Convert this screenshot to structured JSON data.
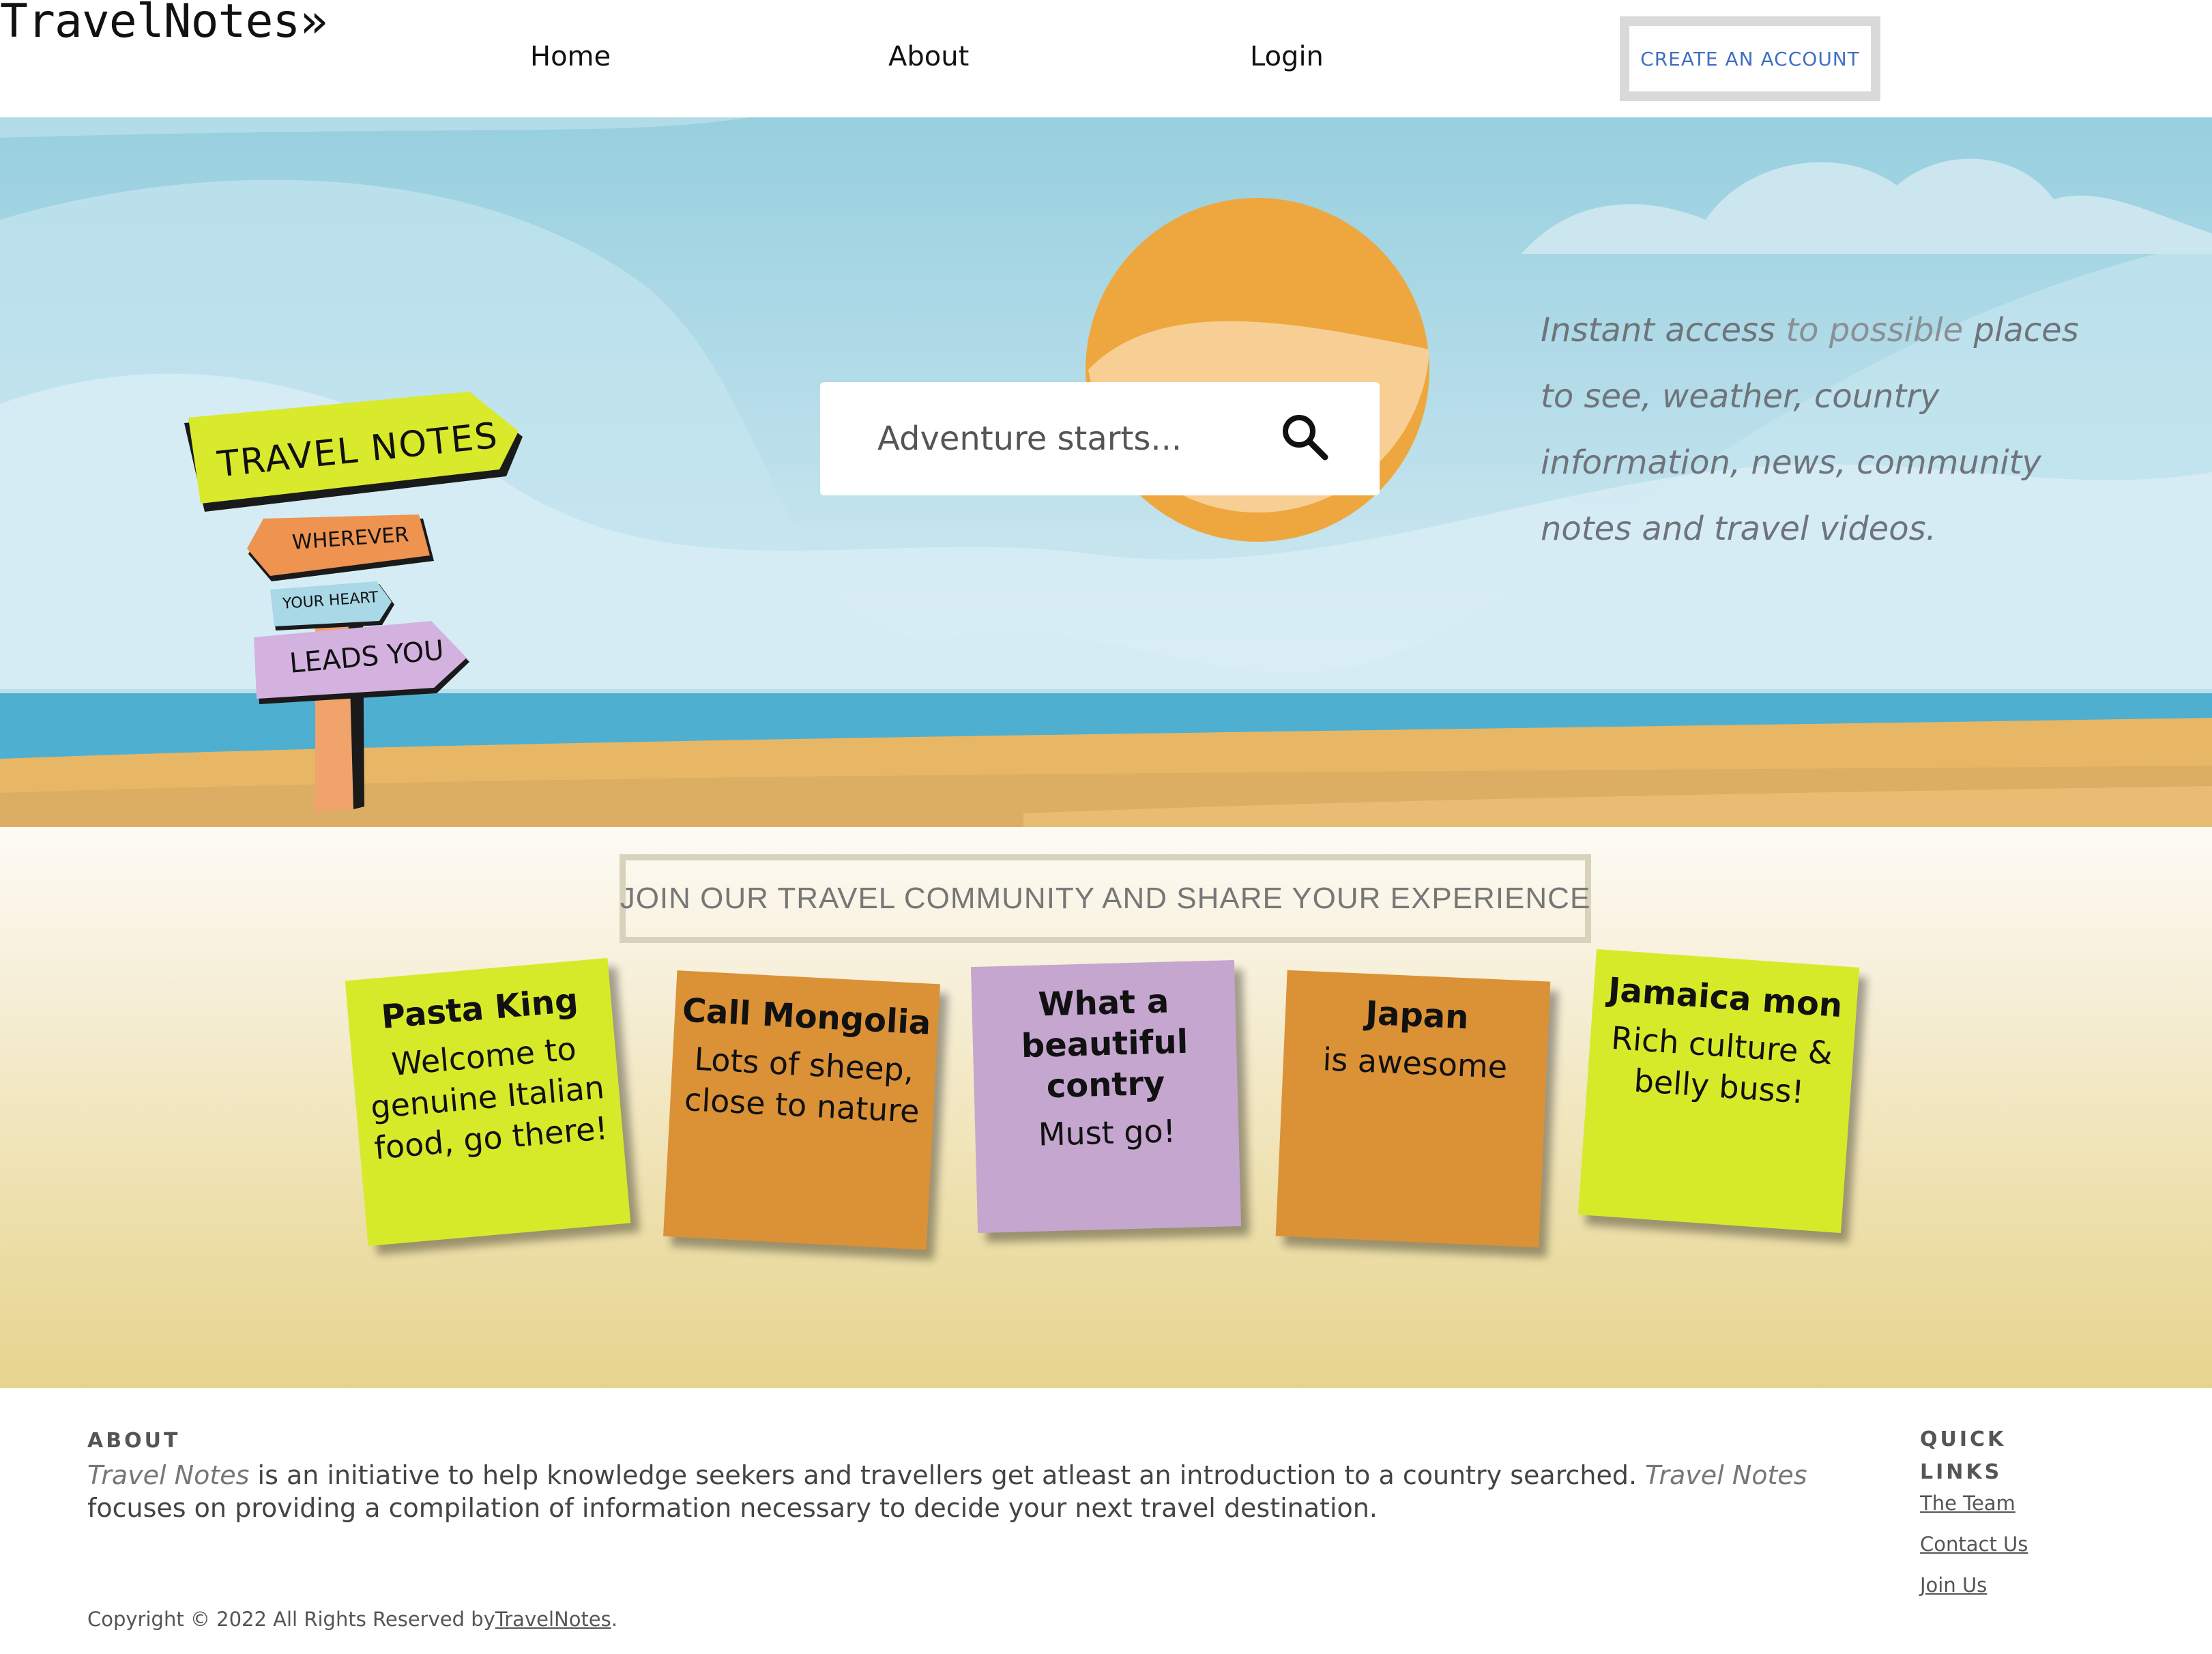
{
  "nav": {
    "brand": "TravelNotes»",
    "links": [
      "Home",
      "About",
      "Login"
    ],
    "cta": "CREATE AN ACCOUNT"
  },
  "hero": {
    "search_placeholder": "Adventure starts...",
    "tagline_parts": [
      "Instant access",
      " to possible ",
      "places",
      " to see, weather, country information, news, community notes and travel videos."
    ],
    "signpost": [
      "TRAVEL NOTES",
      "WHEREVER",
      "YOUR HEART",
      "LEADS YOU"
    ]
  },
  "community": {
    "banner": "JOIN OUR TRAVEL COMMUNITY AND SHARE YOUR EXPERIENCE",
    "notes": [
      {
        "title": "Pasta King",
        "body": "Welcome to genuine Italian food, go there!",
        "color": "#d7ea29"
      },
      {
        "title": "Call Mongolia",
        "body": "Lots of sheep, close to nature",
        "color": "#db9136"
      },
      {
        "title": "What a beautiful contry",
        "body": "Must go!",
        "color": "#c4a6cf"
      },
      {
        "title": "Japan",
        "body": "is awesome",
        "color": "#db9136"
      },
      {
        "title": "Jamaica mon",
        "body": "Rich culture & belly buss!",
        "color": "#d7ea29"
      }
    ]
  },
  "footer": {
    "about_heading": "ABOUT",
    "about_brand": "Travel Notes",
    "about_text_1": " is an initiative to help knowledge seekers and travellers get atleast an introduction to a country searched. ",
    "about_text_2": " focuses on providing a compilation of information necessary to decide your next travel destination.",
    "quick_links_heading": "QUICK LINKS",
    "quick_links": [
      "The Team",
      "Contact Us",
      "Join Us"
    ],
    "copyright_prefix": "Copyright © 2022 All Rights Reserved by",
    "copyright_link": "TravelNotes",
    "copyright_suffix": "."
  },
  "colors": {
    "sky": "#9dd3e2",
    "sea": "#4fafd0",
    "sand": "#e8b766",
    "sun": "#eea73f",
    "cta_text": "#3f6fc3"
  }
}
